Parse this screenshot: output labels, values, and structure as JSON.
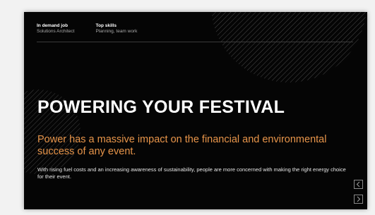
{
  "header": {
    "job_label": "In demand job",
    "job_value": "Solutions Architect",
    "skills_label": "Top skills",
    "skills_value": "Planning, team work"
  },
  "slide": {
    "title": "POWERING YOUR FESTIVAL",
    "subtitle": "Power has a massive impact on the financial and environmental success of any event.",
    "body": "With rising fuel costs and an increasing awareness of sustainability, people are more concerned with making the right energy choice for their event."
  },
  "colors": {
    "background": "#050505",
    "accent": "#e8954a",
    "text": "#ffffff"
  },
  "icons": {
    "prev": "chevron-left-icon",
    "next": "chevron-right-icon"
  }
}
